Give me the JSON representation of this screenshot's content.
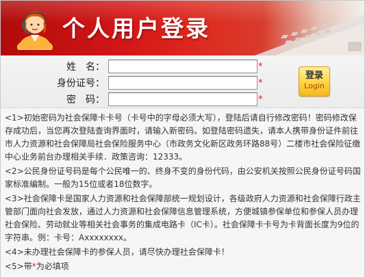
{
  "header": {
    "title": "个人用户登录"
  },
  "form": {
    "name_label": "姓　名：",
    "id_label": "身份证号：",
    "password_label": "密　码：",
    "required_mark": "*",
    "name_value": "",
    "id_value": "",
    "password_value": ""
  },
  "login_button": {
    "label_cn": "登录",
    "label_en": "Login"
  },
  "notes": {
    "note1": "<1>初始密码为社会保障卡卡号（卡号中的字母必须大写），登陆后请自行修改密码！密码修改保存成功后，当您再次登陆查询界面时，请输入新密码。如登陆密码遗失，请本人携带身份证件前往市人力资源和社会保障局社会保险服务中心（市政务文化新区政务环路88号）二楼市社会保险征缴中心业务前台办理相关手续．政策咨询：12333。",
    "note2": "<2>公民身份证号码是每个公民唯一的、终身不变的身份代码，由公安机关按照公民身份证号码国家标准编制。一般为15位或者18位数字。",
    "note3": "<3>社会保障卡是国家人力资源和社会保障部统一规划设计，各级政府人力资源和社会保障行政主管部门面向社会发放，通过人力资源和社会保障信息管理系统，方便城镇参保单位和参保人员办理社会保险、劳动就业等相关社会事务的集成电路卡（IC卡）。社会保障卡卡号为卡背面长度为9位的字符串。例：卡号：Axxxxxxxx。",
    "note4": "<4>未办理社会保障卡的参保人员，请尽快办理社会保障卡！",
    "note5_prefix": "<5>带",
    "note5_star": "*",
    "note5_suffix": "为必填项"
  },
  "colors": {
    "header_red": "#d41717",
    "required_red": "#e31b1b",
    "button_gold": "#ffd54a"
  },
  "icons": {
    "avatar": "user-support-icon",
    "banner_image": "laptop-image"
  }
}
